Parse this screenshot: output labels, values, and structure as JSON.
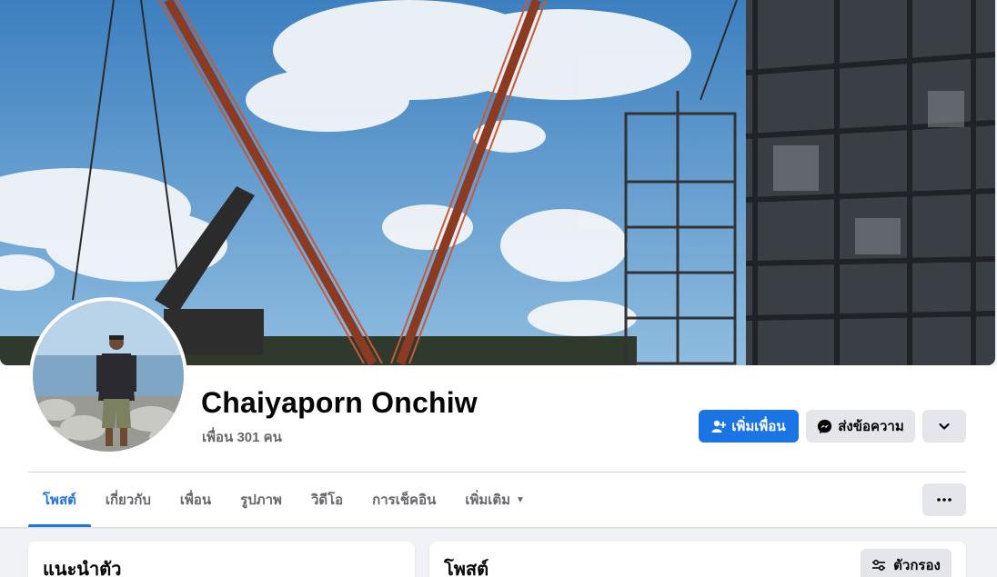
{
  "profile": {
    "name": "Chaiyaporn Onchiw",
    "friends_text": "เพื่อน 301 คน"
  },
  "actions": {
    "add_friend_label": "เพิ่มเพื่อน",
    "message_label": "ส่งข้อความ",
    "chevron_icon": "chevron-down-icon",
    "more_icon": "more-horizontal-icon"
  },
  "tabs": [
    {
      "label": "โพสต์",
      "active": true
    },
    {
      "label": "เกี่ยวกับ",
      "active": false
    },
    {
      "label": "เพื่อน",
      "active": false
    },
    {
      "label": "รูปภาพ",
      "active": false
    },
    {
      "label": "วิดีโอ",
      "active": false
    },
    {
      "label": "การเช็คอิน",
      "active": false
    },
    {
      "label": "เพิ่มเติม",
      "active": false
    }
  ],
  "intro": {
    "title": "แนะนำตัว"
  },
  "posts": {
    "title": "โพสต์",
    "filter_label": "ตัวกรอง"
  },
  "colors": {
    "accent": "#1b74e4",
    "secondary_bg": "#e4e6eb",
    "page_bg": "#f0f2f5"
  }
}
